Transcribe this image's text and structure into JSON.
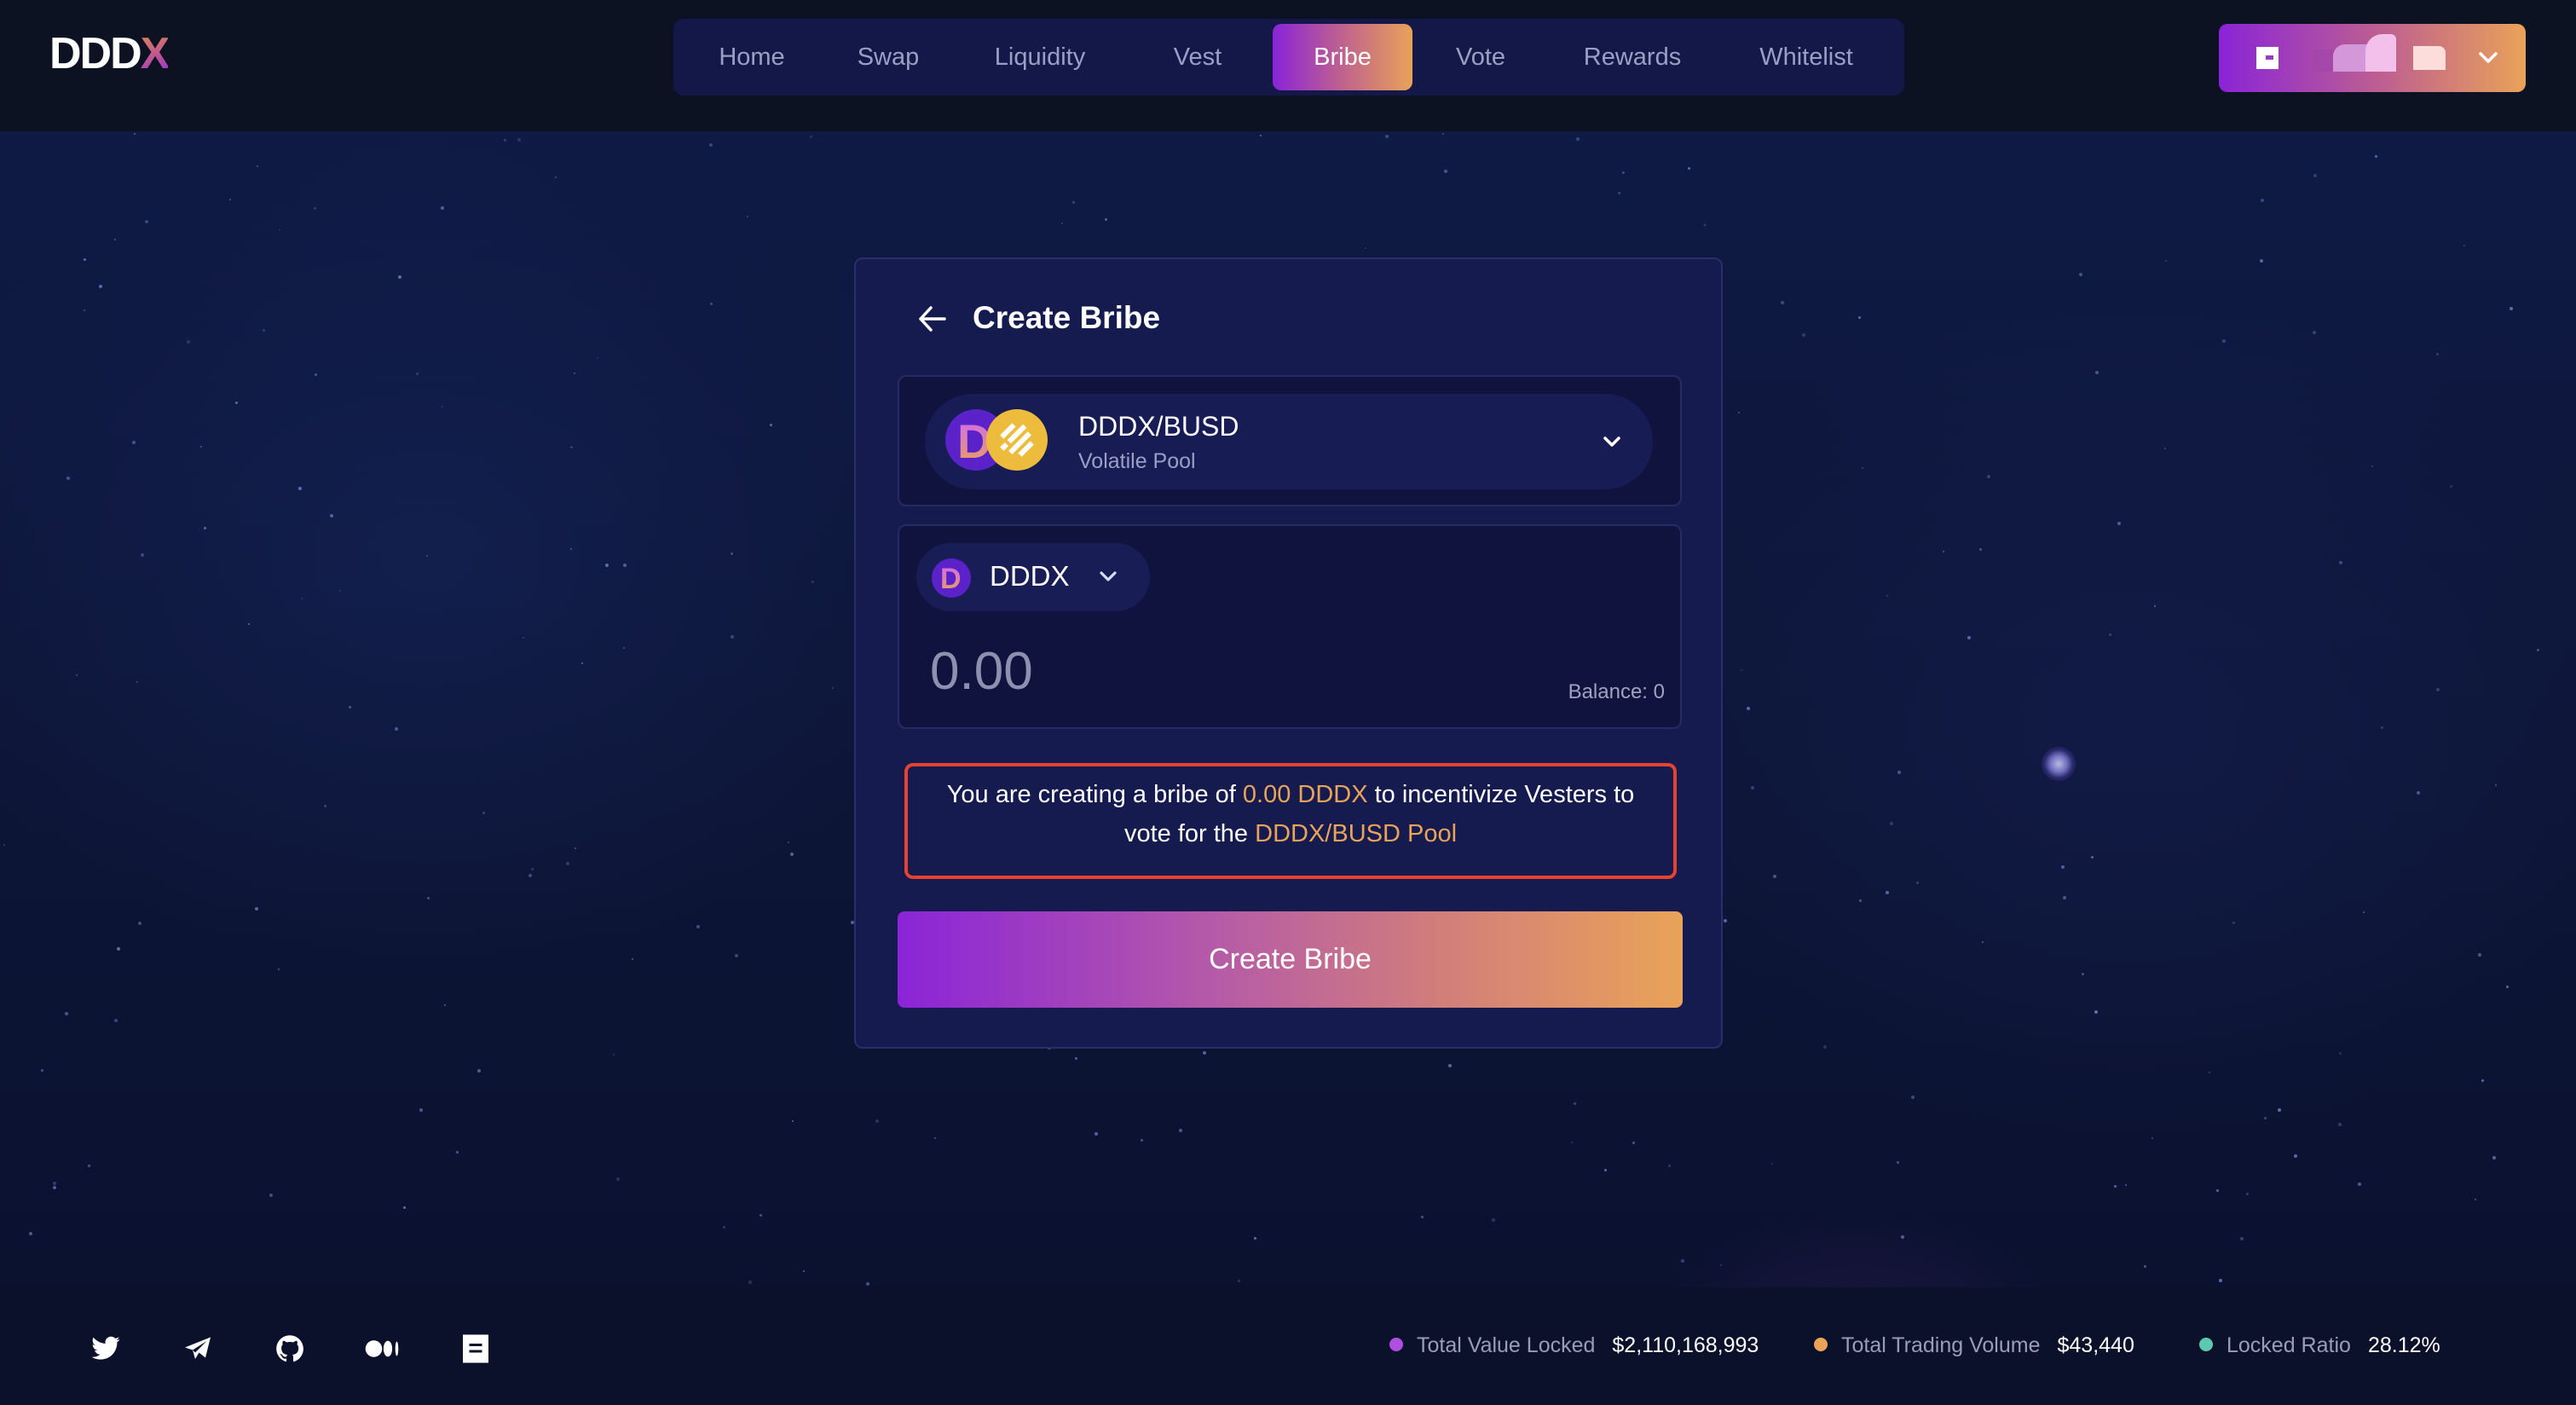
{
  "app": {
    "logo_main": "DDD",
    "logo_accent": "X"
  },
  "nav": {
    "items": [
      {
        "label": "Home",
        "active": false
      },
      {
        "label": "Swap",
        "active": false
      },
      {
        "label": "Liquidity",
        "active": false
      },
      {
        "label": "Vest",
        "active": false
      },
      {
        "label": "Bribe",
        "active": true
      },
      {
        "label": "Vote",
        "active": false
      },
      {
        "label": "Rewards",
        "active": false
      },
      {
        "label": "Whitelist",
        "active": false
      }
    ]
  },
  "wallet": {
    "icon": "wallet-icon",
    "address": "redacted",
    "menu_icon": "chevron-down-icon"
  },
  "card": {
    "back_icon": "arrow-left-icon",
    "title": "Create Bribe",
    "pool_select": {
      "name": "DDDX/BUSD",
      "type": "Volatile Pool",
      "token_a_icon": "dddx-token-icon",
      "token_b_icon": "busd-token-icon",
      "chevron_icon": "chevron-down-icon"
    },
    "token_select": {
      "symbol": "DDDX",
      "icon": "dddx-token-icon",
      "chevron_icon": "chevron-down-icon"
    },
    "amount": {
      "value": "",
      "placeholder": "0.00"
    },
    "balance_label": "Balance: 0",
    "info": {
      "prefix": "You are creating a bribe of ",
      "amount": "0.00 DDDX",
      "middle": " to incentivize Vesters to vote for the ",
      "pool": "DDDX/BUSD Pool"
    },
    "submit_label": "Create Bribe"
  },
  "footer": {
    "socials": [
      {
        "name": "twitter-icon"
      },
      {
        "name": "telegram-icon"
      },
      {
        "name": "github-icon"
      },
      {
        "name": "medium-icon"
      },
      {
        "name": "docs-icon"
      }
    ],
    "stats": [
      {
        "label": "Total Value Locked",
        "value": "$2,110,168,993",
        "color": "#b04ee0"
      },
      {
        "label": "Total Trading Volume",
        "value": "$43,440",
        "color": "#e9a45a"
      },
      {
        "label": "Locked Ratio",
        "value": "28.12%",
        "color": "#5cc9b0"
      }
    ]
  },
  "colors": {
    "accent_gradient_start": "#8a24d8",
    "accent_gradient_end": "#eaa358",
    "highlight": "#e9a45a",
    "warning_border": "#e5432d",
    "card_bg": "#151a4f"
  }
}
